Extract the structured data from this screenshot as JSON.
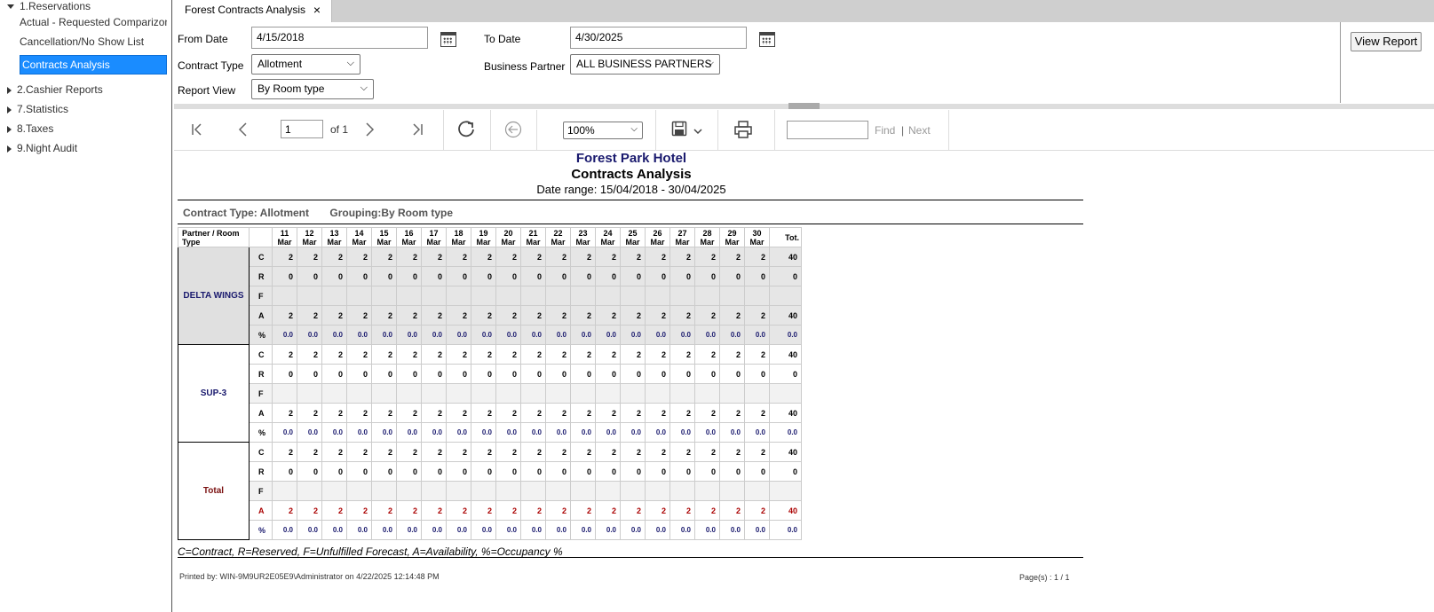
{
  "sidebar": {
    "groups": [
      {
        "label": "1.Reservations",
        "expanded": true
      },
      {
        "label": "2.Cashier Reports",
        "expanded": false
      },
      {
        "label": "7.Statistics",
        "expanded": false
      },
      {
        "label": "8.Taxes",
        "expanded": false
      },
      {
        "label": "9.Night Audit",
        "expanded": false
      }
    ],
    "items": [
      {
        "label": "Actual - Requested Comparizon"
      },
      {
        "label": "Cancellation/No Show List"
      },
      {
        "label": "Contracts Analysis",
        "active": true
      }
    ]
  },
  "tab": {
    "label": "Forest Contracts Analysis",
    "close": "×"
  },
  "params": {
    "from_date_label": "From Date",
    "from_date_value": "4/15/2018",
    "to_date_label": "To Date",
    "to_date_value": "4/30/2025",
    "contract_type_label": "Contract Type",
    "contract_type_value": "Allotment",
    "business_partner_label": "Business Partner",
    "business_partner_value": "ALL BUSINESS PARTNERS",
    "report_view_label": "Report View",
    "report_view_value": "By Room type",
    "view_report_button": "View Report"
  },
  "toolbar": {
    "page_value": "1",
    "of_label": "of 1",
    "zoom_value": "100%",
    "find_label": "Find",
    "next_label": "Next",
    "divider": "|"
  },
  "report": {
    "hotel": "Forest Park Hotel",
    "title": "Contracts Analysis",
    "date_range": "Date range: 15/04/2018 - 30/04/2025",
    "contract_type": "Contract Type: Allotment",
    "grouping": "Grouping:By Room type",
    "col_header": "Partner / Room Type",
    "days": [
      "11",
      "12",
      "13",
      "14",
      "15",
      "16",
      "17",
      "18",
      "19",
      "20",
      "21",
      "22",
      "23",
      "24",
      "25",
      "26",
      "27",
      "28",
      "29",
      "30"
    ],
    "month": "Mar",
    "total_header": "Tot.",
    "groups": [
      {
        "name": "DELTA WINGS",
        "rows": [
          {
            "code": "C",
            "value": "2",
            "total": "40"
          },
          {
            "code": "R",
            "value": "0",
            "total": "0"
          },
          {
            "code": "F",
            "value": "",
            "total": ""
          },
          {
            "code": "A",
            "value": "2",
            "total": "40"
          },
          {
            "code": "%",
            "value": "0.0",
            "total": "0.0"
          }
        ]
      },
      {
        "name": "SUP-3",
        "rows": [
          {
            "code": "C",
            "value": "2",
            "total": "40"
          },
          {
            "code": "R",
            "value": "0",
            "total": "0"
          },
          {
            "code": "F",
            "value": "",
            "total": ""
          },
          {
            "code": "A",
            "value": "2",
            "total": "40"
          },
          {
            "code": "%",
            "value": "0.0",
            "total": "0.0"
          }
        ]
      },
      {
        "name": "Total",
        "rows": [
          {
            "code": "C",
            "value": "2",
            "total": "40"
          },
          {
            "code": "R",
            "value": "0",
            "total": "0"
          },
          {
            "code": "F",
            "value": "",
            "total": ""
          },
          {
            "code": "A",
            "value": "2",
            "total": "40"
          },
          {
            "code": "%",
            "value": "0.0",
            "total": "0.0"
          }
        ]
      }
    ],
    "legend": "C=Contract, R=Reserved, F=Unfulfilled Forecast, A=Availability, %=Occupancy %",
    "printed_by": "Printed by: WIN-9M9UR2E05E9\\Administrator on 4/22/2025 12:14:48 PM",
    "pages": "Page(s) : 1  /  1"
  }
}
